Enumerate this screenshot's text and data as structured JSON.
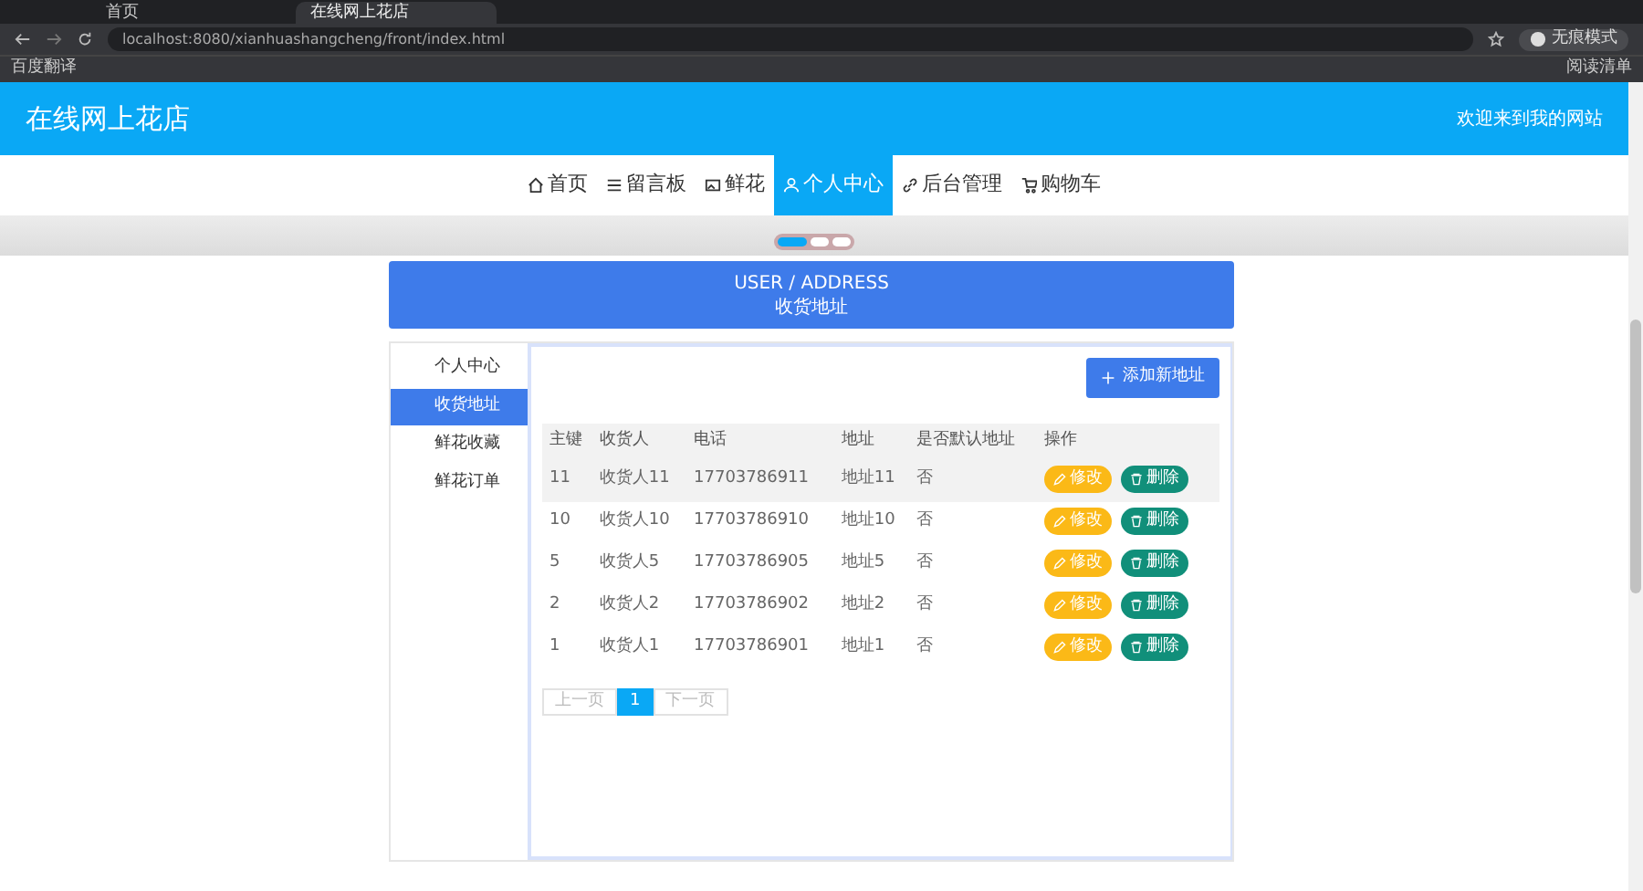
{
  "browser": {
    "tabs": [
      {
        "title": "首页",
        "selected": false
      },
      {
        "title": "在线网上花店",
        "selected": true
      }
    ],
    "url": "localhost:8080/xianhuashangcheng/front/index.html",
    "profile": "无痕模式",
    "bookmarks": [
      "百度翻译"
    ],
    "reading_list": "阅读清单"
  },
  "site": {
    "title": "在线网上花店",
    "welcome": "欢迎来到我的网站",
    "nav": [
      {
        "kind": "home",
        "label": "首页",
        "selected": false
      },
      {
        "kind": "list",
        "label": "留言板",
        "selected": false
      },
      {
        "kind": "image",
        "label": "鲜花",
        "selected": false
      },
      {
        "kind": "user",
        "label": "个人中心",
        "selected": true
      },
      {
        "kind": "link",
        "label": "后台管理",
        "selected": false
      },
      {
        "kind": "cart",
        "label": "购物车",
        "selected": false
      }
    ],
    "carousel": [
      {
        "selected": true
      },
      {
        "selected": false
      },
      {
        "selected": false
      }
    ],
    "page_header": {
      "english": "USER / ADDRESS",
      "chinese": "收货地址"
    },
    "sidebar": [
      {
        "label": "个人中心",
        "selected": false
      },
      {
        "label": "收货地址",
        "selected": true
      },
      {
        "label": "鲜花收藏",
        "selected": false
      },
      {
        "label": "鲜花订单",
        "selected": false
      }
    ],
    "add_button": "添加新地址",
    "table": {
      "columns": [
        "主键",
        "收货人",
        "电话",
        "地址",
        "是否默认地址",
        "操作"
      ],
      "rows": [
        {
          "id": "11",
          "name": "收货人11",
          "phone": "17703786911",
          "address": "地址11",
          "default": "否",
          "edit": "修改",
          "delete": "删除",
          "hovered": true
        },
        {
          "id": "10",
          "name": "收货人10",
          "phone": "17703786910",
          "address": "地址10",
          "default": "否",
          "edit": "修改",
          "delete": "删除",
          "hovered": false
        },
        {
          "id": "5",
          "name": "收货人5",
          "phone": "17703786905",
          "address": "地址5",
          "default": "否",
          "edit": "修改",
          "delete": "删除",
          "hovered": false
        },
        {
          "id": "2",
          "name": "收货人2",
          "phone": "17703786902",
          "address": "地址2",
          "default": "否",
          "edit": "修改",
          "delete": "删除",
          "hovered": false
        },
        {
          "id": "1",
          "name": "收货人1",
          "phone": "17703786901",
          "address": "地址1",
          "default": "否",
          "edit": "修改",
          "delete": "删除",
          "hovered": false
        }
      ]
    },
    "pagination": {
      "prev": "上一页",
      "pages": [
        {
          "label": "1",
          "selected": true
        }
      ],
      "next": "下一页"
    }
  }
}
